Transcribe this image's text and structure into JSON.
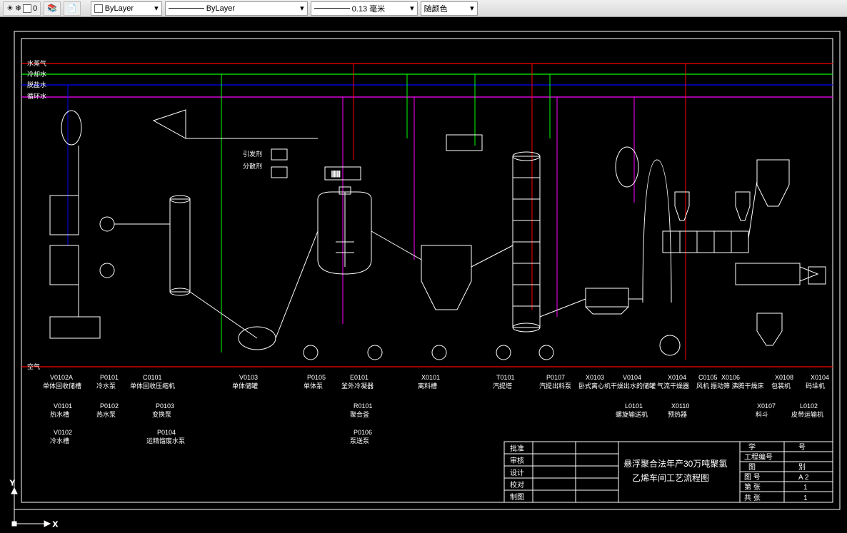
{
  "toolbar": {
    "layer_color_label": "0",
    "layer_select": "ByLayer",
    "linetype_select": "ByLayer",
    "lineweight_select": "0.13 毫米",
    "color_select": "随颜色"
  },
  "utilities": {
    "steam": "水蒸气",
    "cooling": "冷却水",
    "reflux": "脱盐水",
    "circ": "循环水",
    "air": "空气"
  },
  "chem_labels": {
    "initiator": "引发剂",
    "dispersant": "分散剂"
  },
  "equipment_row1": [
    {
      "id": "V0102A",
      "name": "单体回收储槽"
    },
    {
      "id": "P0101",
      "name": "冷水泵"
    },
    {
      "id": "C0101",
      "name": "单体回收压缩机"
    },
    {
      "id": "V0103",
      "name": "单体储罐"
    },
    {
      "id": "P0105",
      "name": "单体泵"
    },
    {
      "id": "E0101",
      "name": "釜外冷凝器"
    },
    {
      "id": "X0101",
      "name": "离料槽"
    },
    {
      "id": "T0101",
      "name": "汽提塔"
    },
    {
      "id": "P0107",
      "name": "汽提出料泵"
    },
    {
      "id": "X0103",
      "name": "卧式离心机"
    },
    {
      "id": "V0104",
      "name": "干燥出水的储罐"
    },
    {
      "id": "X0104",
      "name": "气流干燥器"
    },
    {
      "id": "C0105",
      "name": "风机"
    },
    {
      "id": "X0106",
      "name": "振动筛 沸腾干燥床"
    },
    {
      "id": "X0108",
      "name": "包装机"
    },
    {
      "id": "X0104",
      "name": "码垛机"
    }
  ],
  "equipment_row2": [
    {
      "id": "V0101",
      "name": "热水槽"
    },
    {
      "id": "P0102",
      "name": "热水泵"
    },
    {
      "id": "P0103",
      "name": "变换泵"
    },
    {
      "id": "R0101",
      "name": "聚合釜"
    },
    {
      "id": "L0101",
      "name": "螺旋输送机"
    },
    {
      "id": "X0110",
      "name": "预热器"
    },
    {
      "id": "X0107",
      "name": "料斗"
    },
    {
      "id": "L0102",
      "name": "皮带运输机"
    }
  ],
  "equipment_row3": [
    {
      "id": "V0102",
      "name": "冷水槽"
    },
    {
      "id": "P0104",
      "name": "运精馏废水泵"
    },
    {
      "id": "P0106",
      "name": "泵送泵"
    }
  ],
  "title_block": {
    "rows_left": [
      "批准",
      "审核",
      "设计",
      "校对",
      "制图"
    ],
    "title_line1": "悬浮聚合法年产30万吨聚氯",
    "title_line2": "乙烯车间工艺流程图",
    "right_rows": [
      {
        "l": "学",
        "r": "号"
      },
      {
        "l": "工程编号",
        "r": ""
      },
      {
        "l": "图",
        "r": "别"
      },
      {
        "l": "图   号",
        "r": "A 2"
      },
      {
        "l": "第   张",
        "r": "1"
      },
      {
        "l": "共   张",
        "r": "1"
      }
    ]
  },
  "ucs": {
    "x": "X",
    "y": "Y"
  }
}
